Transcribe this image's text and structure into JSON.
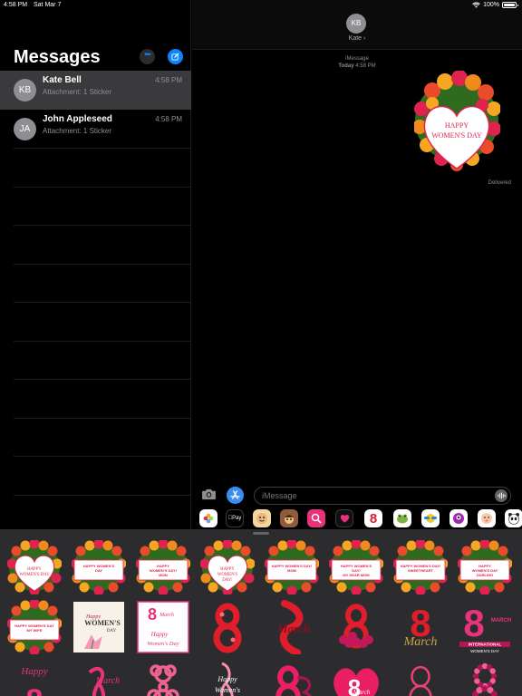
{
  "status": {
    "time": "4:58 PM",
    "date": "Sat Mar 7",
    "battery": "100%"
  },
  "sidebar": {
    "title": "Messages",
    "conversations": [
      {
        "initials": "KB",
        "name": "Kate Bell",
        "preview": "Attachment: 1 Sticker",
        "time": "4:58 PM",
        "selected": true
      },
      {
        "initials": "JA",
        "name": "John Appleseed",
        "preview": "Attachment: 1 Sticker",
        "time": "4:58 PM",
        "selected": false
      }
    ]
  },
  "conversation": {
    "contact_initials": "KB",
    "contact_name": "Kate ›",
    "service_label": "iMessage",
    "timestamp_day": "Today",
    "timestamp_time": "4:58 PM",
    "sent_sticker_text": [
      "HAPPY",
      "WOMEN'S DAY"
    ],
    "delivery_status": "Delivered"
  },
  "input": {
    "placeholder": "iMessage"
  },
  "app_drawer": {
    "apps": [
      "photos-icon",
      "apple-pay-icon",
      "memoji-icon",
      "animoji-icon",
      "image-search-icon",
      "digital-touch-icon",
      "eight-march-app-icon",
      "frog-sticker-icon",
      "sunglasses-sticker-icon",
      "monster-sticker-icon",
      "baby-sticker-icon",
      "panda-sticker-icon"
    ],
    "apple_pay_label": "Pay",
    "eight_label": "8"
  },
  "colors": {
    "accent": "#0a84ff",
    "rose": "#e8337a",
    "red": "#e01e2b",
    "panel": "#2c2c2e"
  },
  "sticker_panel": {
    "row1": [
      {
        "kind": "heart",
        "lines": [
          "HAPPY",
          "WOMEN'S DAY"
        ]
      },
      {
        "kind": "card",
        "lines": [
          "HAPPY WOMEN'S",
          "DAY"
        ]
      },
      {
        "kind": "card",
        "lines": [
          "HAPPY",
          "WOMEN'S DAY!",
          "MOM"
        ]
      },
      {
        "kind": "heart",
        "lines": [
          "HAPPY",
          "WOMEN'S",
          "DAY!"
        ]
      },
      {
        "kind": "card",
        "lines": [
          "HAPPY WOMEN'S DAY!",
          "MOM"
        ]
      },
      {
        "kind": "card",
        "lines": [
          "HAPPY WOMEN'S",
          "DAY!",
          "MY DEAR MOM"
        ]
      },
      {
        "kind": "card",
        "lines": [
          "HAPPY WOMEN'S DAY!",
          "SWEETHEART"
        ]
      },
      {
        "kind": "card",
        "lines": [
          "HAPPY",
          "WOMEN'S DAY",
          "DARLING"
        ]
      }
    ],
    "row2": [
      {
        "kind": "card",
        "lines": [
          "HAPPY WOMEN'S DAY",
          "MY WIFE"
        ]
      },
      {
        "kind": "womens-card",
        "lines": [
          "Happy",
          "WOMEN'S",
          "DAY"
        ]
      },
      {
        "kind": "march-card",
        "lines": [
          "8",
          "March",
          "Happy",
          "Women's Day"
        ]
      },
      {
        "kind": "eight-red",
        "lines": [
          "8"
        ]
      },
      {
        "kind": "march-script",
        "lines": [
          "March"
        ]
      },
      {
        "kind": "eight-roses",
        "lines": [
          "8"
        ]
      },
      {
        "kind": "eight-gold",
        "lines": [
          "8",
          "March"
        ]
      },
      {
        "kind": "eight-pink-intl",
        "lines": [
          "8",
          "MARCH",
          "INTERNATIONAL",
          "WOMEN'S DAY"
        ]
      }
    ],
    "row3": [
      {
        "kind": "happy-eight",
        "lines": [
          "Happy",
          "8"
        ]
      },
      {
        "kind": "ribbon-march",
        "lines": [
          "March"
        ]
      },
      {
        "kind": "eight-pink",
        "lines": [
          "8"
        ]
      },
      {
        "kind": "ribbon-script",
        "lines": [
          "Happy",
          "Women's"
        ]
      },
      {
        "kind": "eight-ribbon",
        "lines": [
          "8"
        ]
      },
      {
        "kind": "heart-march",
        "lines": [
          "8",
          "March"
        ]
      },
      {
        "kind": "eight-thin",
        "lines": [
          "8"
        ]
      },
      {
        "kind": "eight-dots",
        "lines": [
          "8"
        ]
      }
    ]
  }
}
